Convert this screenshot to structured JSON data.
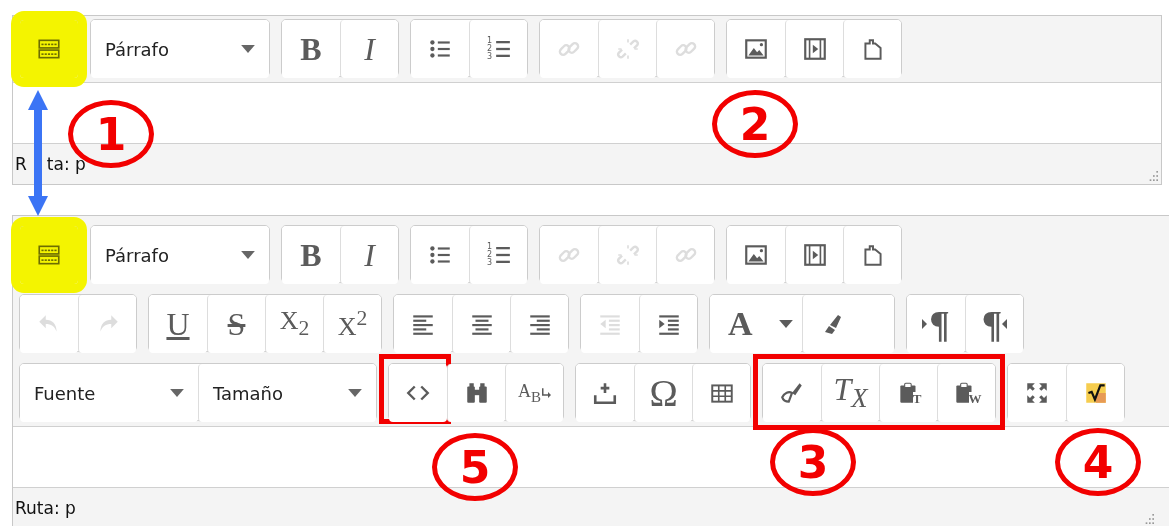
{
  "editors": [
    {
      "toolbars": [
        {
          "groups": [
            {
              "items": [
                {
                  "kind": "toggle",
                  "highlighted": true,
                  "disabled": false
                }
              ]
            },
            {
              "items": [
                {
                  "kind": "dropdown",
                  "label": "Párrafo",
                  "disabled": false
                }
              ]
            },
            {
              "items": [
                {
                  "kind": "bold",
                  "label": "B",
                  "disabled": false
                },
                {
                  "kind": "italic",
                  "label": "I",
                  "disabled": false
                }
              ]
            },
            {
              "items": [
                {
                  "kind": "bullist",
                  "disabled": false
                },
                {
                  "kind": "numlist",
                  "label": "123",
                  "disabled": false
                }
              ]
            },
            {
              "items": [
                {
                  "kind": "link",
                  "disabled": true
                },
                {
                  "kind": "unlink",
                  "disabled": true
                },
                {
                  "kind": "anchor",
                  "disabled": true
                }
              ]
            },
            {
              "items": [
                {
                  "kind": "image",
                  "disabled": false
                },
                {
                  "kind": "media",
                  "disabled": false
                },
                {
                  "kind": "file",
                  "disabled": false
                }
              ]
            }
          ]
        }
      ],
      "status_parts": [
        "R",
        "ta: p"
      ],
      "cut": false
    },
    {
      "toolbars": [
        {
          "groups": [
            {
              "items": [
                {
                  "kind": "toggle",
                  "highlighted": true,
                  "disabled": false
                }
              ]
            },
            {
              "items": [
                {
                  "kind": "dropdown",
                  "label": "Párrafo",
                  "disabled": false
                }
              ]
            },
            {
              "items": [
                {
                  "kind": "bold",
                  "label": "B",
                  "disabled": false
                },
                {
                  "kind": "italic",
                  "label": "I",
                  "disabled": false
                }
              ]
            },
            {
              "items": [
                {
                  "kind": "bullist",
                  "disabled": false
                },
                {
                  "kind": "numlist",
                  "label": "123",
                  "disabled": false
                }
              ]
            },
            {
              "items": [
                {
                  "kind": "link",
                  "disabled": true
                },
                {
                  "kind": "unlink",
                  "disabled": true
                },
                {
                  "kind": "anchor",
                  "disabled": true
                }
              ]
            },
            {
              "items": [
                {
                  "kind": "image",
                  "disabled": false
                },
                {
                  "kind": "media",
                  "disabled": false
                },
                {
                  "kind": "file",
                  "disabled": false
                }
              ]
            }
          ]
        },
        {
          "groups": [
            {
              "items": [
                {
                  "kind": "undo",
                  "disabled": true
                },
                {
                  "kind": "redo",
                  "disabled": true
                }
              ]
            },
            {
              "items": [
                {
                  "kind": "underline",
                  "label": "U",
                  "disabled": false
                },
                {
                  "kind": "strike",
                  "label": "S",
                  "disabled": false
                },
                {
                  "kind": "sub",
                  "label": "X$_{2}$",
                  "disabled": false
                },
                {
                  "kind": "sup",
                  "label": "X$^{2}$",
                  "disabled": false
                }
              ]
            },
            {
              "items": [
                {
                  "kind": "alignleft",
                  "disabled": false
                },
                {
                  "kind": "aligncenter",
                  "disabled": false
                },
                {
                  "kind": "alignright",
                  "disabled": false
                }
              ]
            },
            {
              "items": [
                {
                  "kind": "outdent",
                  "disabled": true
                },
                {
                  "kind": "indent",
                  "disabled": false
                }
              ]
            },
            {
              "items": [
                {
                  "kind": "forecolor",
                  "label": "A",
                  "disabled": false
                },
                {
                  "kind": "backcolor",
                  "disabled": false
                }
              ]
            },
            {
              "items": [
                {
                  "kind": "ltr",
                  "label": "¶",
                  "disabled": false
                },
                {
                  "kind": "rtl",
                  "label": "¶",
                  "disabled": false
                }
              ]
            }
          ]
        },
        {
          "groups": [
            {
              "items": [
                {
                  "kind": "dropdown",
                  "label": "Fuente",
                  "disabled": false
                },
                {
                  "kind": "dropdown",
                  "label": "Tamaño",
                  "disabled": false
                }
              ]
            },
            {
              "items": [
                {
                  "kind": "code",
                  "marked": true,
                  "disabled": false
                },
                {
                  "kind": "search",
                  "disabled": false
                },
                {
                  "kind": "replace",
                  "label": "A$_{B}$",
                  "disabled": false
                }
              ]
            },
            {
              "items": [
                {
                  "kind": "upload",
                  "disabled": false
                },
                {
                  "kind": "charmap",
                  "label": "Ω",
                  "disabled": false
                },
                {
                  "kind": "table",
                  "disabled": false
                }
              ]
            },
            {
              "marked": true,
              "items": [
                {
                  "kind": "cleanup",
                  "disabled": false
                },
                {
                  "kind": "removeformat",
                  "label": "T$_{X}$",
                  "disabled": false
                },
                {
                  "kind": "pastetext",
                  "label": "T",
                  "disabled": false
                },
                {
                  "kind": "pasteword",
                  "label": "W",
                  "disabled": false
                }
              ]
            },
            {
              "items": [
                {
                  "kind": "fullscreen",
                  "disabled": false
                },
                {
                  "kind": "math",
                  "disabled": false
                }
              ]
            }
          ]
        }
      ],
      "status": "Ruta: p",
      "cut": true
    }
  ],
  "callouts": [
    {
      "label": "1"
    },
    {
      "label": "2"
    },
    {
      "label": "5"
    },
    {
      "label": "3"
    },
    {
      "label": "4"
    }
  ]
}
